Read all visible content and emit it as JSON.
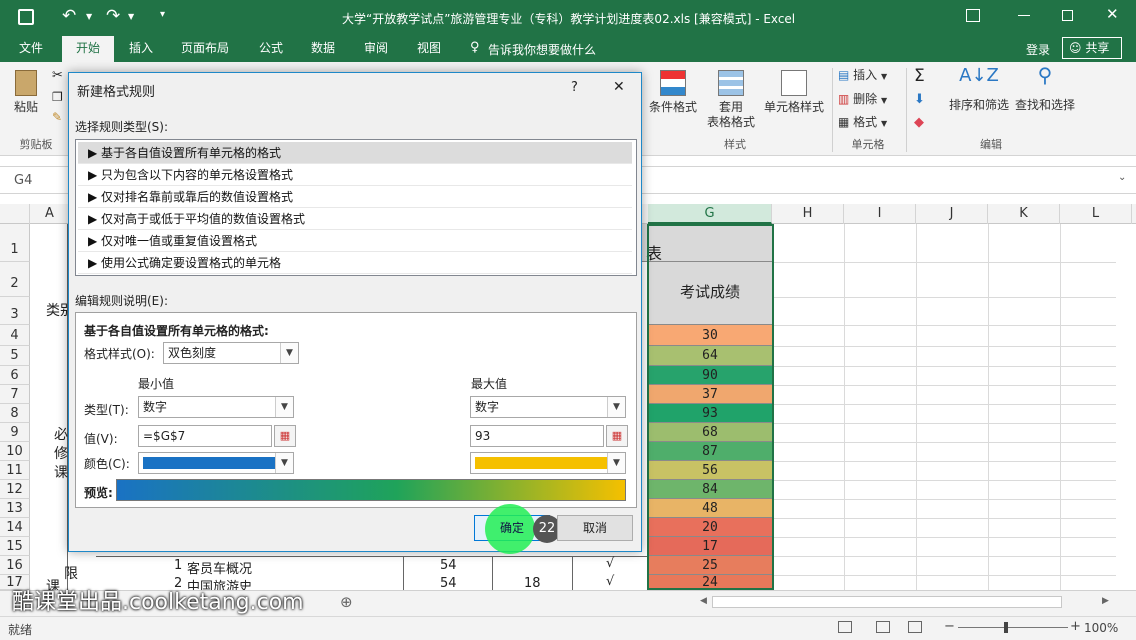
{
  "window": {
    "title": "大学“开放教学试点”旅游管理专业（专科）教学计划进度表02.xls  [兼容模式] - Excel"
  },
  "ribbon_tabs": [
    "文件",
    "开始",
    "插入",
    "页面布局",
    "公式",
    "数据",
    "审阅",
    "视图"
  ],
  "tell_me": "告诉我你想要做什么",
  "account": {
    "login": "登录",
    "share": "共享"
  },
  "ribbon": {
    "paste": "粘贴",
    "clipboard": "剪贴板",
    "cond_format": "条件格式",
    "table_format_1": "套用",
    "table_format_2": "表格格式",
    "cell_style": "单元格样式",
    "styles_group": "样式",
    "insert": "插入",
    "delete": "删除",
    "format": "格式",
    "cells_group": "单元格",
    "sort_filter": "排序和筛选",
    "find_select": "查找和选择",
    "edit_group": "编辑"
  },
  "name_box": "G4",
  "columns": [
    "A",
    "G",
    "H",
    "I",
    "J",
    "K",
    "L"
  ],
  "rows": [
    "1",
    "2",
    "3",
    "4",
    "5",
    "6",
    "7",
    "8",
    "9",
    "10",
    "11",
    "12",
    "13",
    "14",
    "15",
    "16",
    "17"
  ],
  "sheet_left": {
    "title_fragment": "表",
    "header_g": "考试成绩",
    "category": "类别",
    "req_chars": [
      "必",
      "修",
      "课"
    ],
    "limit_chars": [
      "限",
      "课"
    ],
    "row16": {
      "no": "1",
      "name": "客员车概况",
      "hours": "54",
      "check": "√"
    },
    "row17": {
      "no": "2",
      "name": "中国旅游史",
      "hours": "54",
      "credits": "18",
      "check": "√"
    }
  },
  "chart_data": {
    "type": "table",
    "column": "考试成绩",
    "rows": [
      "4",
      "5",
      "6",
      "7",
      "8",
      "9",
      "10",
      "11",
      "12",
      "13",
      "14",
      "15",
      "16",
      "17"
    ],
    "values": [
      30,
      64,
      90,
      37,
      93,
      68,
      87,
      56,
      84,
      48,
      20,
      17,
      25,
      24
    ],
    "colors": [
      "#f8a873",
      "#a8c070",
      "#27a36c",
      "#f0a76e",
      "#20a36a",
      "#9cbd6e",
      "#4fae6b",
      "#c8c264",
      "#6eb56b",
      "#e8b466",
      "#e8705c",
      "#e56a5a",
      "#e77d5d",
      "#e8785a"
    ]
  },
  "dialog": {
    "title": "新建格式规则",
    "help": "?",
    "close": "✕",
    "select_type_label": "选择规则类型(S):",
    "rule_types": [
      "基于各自值设置所有单元格的格式",
      "只为包含以下内容的单元格设置格式",
      "仅对排名靠前或靠后的数值设置格式",
      "仅对高于或低于平均值的数值设置格式",
      "仅对唯一值或重复值设置格式",
      "使用公式确定要设置格式的单元格"
    ],
    "edit_desc_label": "编辑规则说明(E):",
    "desc_heading": "基于各自值设置所有单元格的格式:",
    "format_style_label": "格式样式(O):",
    "format_style_value": "双色刻度",
    "min_label": "最小值",
    "max_label": "最大值",
    "type_label": "类型(T):",
    "value_label": "值(V):",
    "color_label": "颜色(C):",
    "min_type": "数字",
    "max_type": "数字",
    "min_value": "=$G$7",
    "max_value": "93",
    "min_color": "#1a72c4",
    "max_color": "#f5c000",
    "preview_label": "预览:",
    "ok": "确定",
    "cancel": "取消",
    "step_badge": "22"
  },
  "sheet_tab_add": "⊕",
  "status": {
    "ready": "就绪",
    "zoom": "100%"
  },
  "watermark": "酷课堂出品.coolketang.com"
}
